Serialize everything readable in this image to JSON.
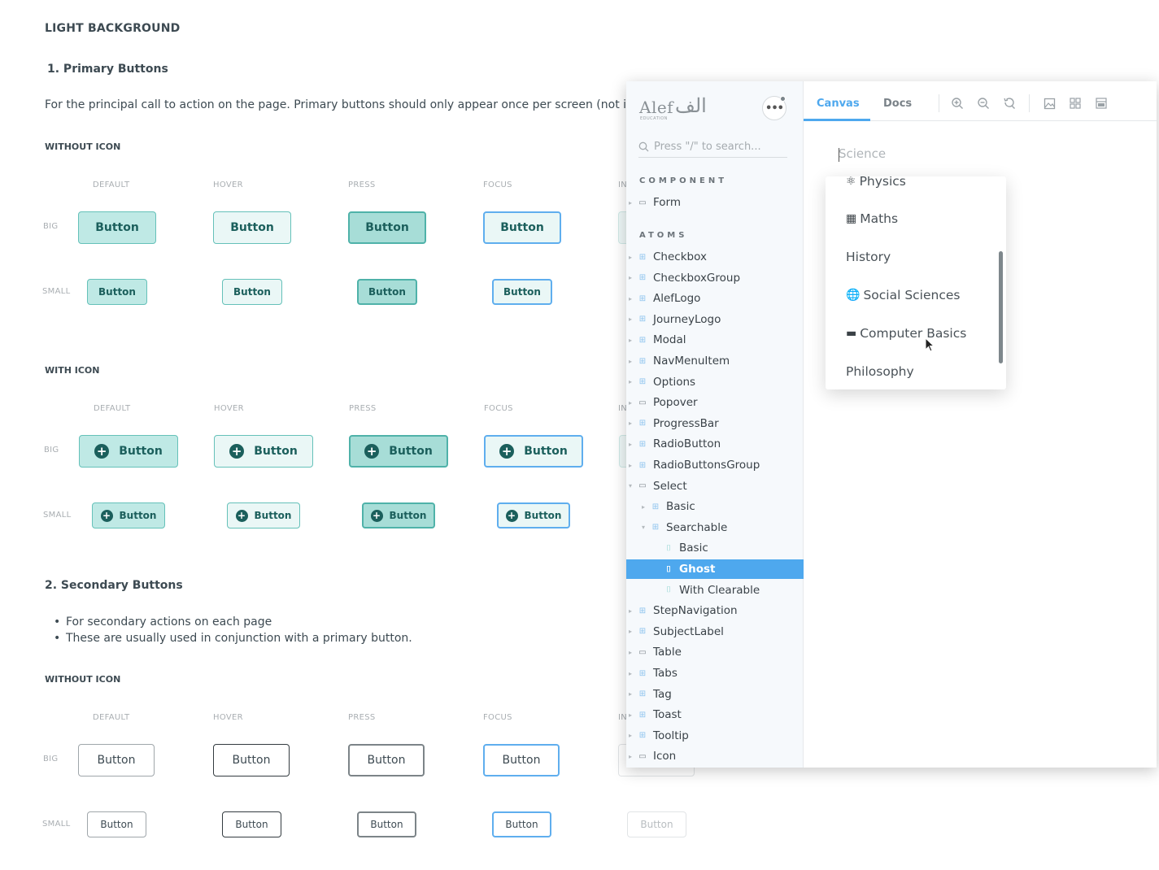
{
  "doc": {
    "title": "LIGHT BACKGROUND",
    "primary": {
      "heading": "1.  Primary Buttons",
      "description": "For the principal call to action on the page. Primary buttons should only appear once per screen (not includ",
      "without_icon": "WITHOUT ICON",
      "with_icon": "WITH ICON"
    },
    "secondary": {
      "heading": "2. Secondary Buttons",
      "bullets": [
        "For secondary actions on each page",
        "These are usually used in conjunction with a primary button."
      ],
      "without_icon": "WITHOUT ICON"
    },
    "states": {
      "default": "DEFAULT",
      "hover": "HOVER",
      "press": "PRESS",
      "focus": "FOCUS",
      "inactive_partial": "IN"
    },
    "sizes": {
      "big": "BIG",
      "small": "SMALL"
    },
    "button_label": "Button",
    "plus_glyph": "+"
  },
  "storybook": {
    "logo_text": "Alef",
    "logo_sub": "EDUCATION",
    "logo_arabic": "الف",
    "menu_glyph": "•••",
    "search_placeholder": "Press \"/\" to search...",
    "sections": {
      "component": "COMPONENT",
      "atoms": "ATOMS"
    },
    "component_items": [
      {
        "label": "Form",
        "kind": "folder"
      }
    ],
    "atoms_items": [
      {
        "label": "Checkbox",
        "kind": "comp"
      },
      {
        "label": "CheckboxGroup",
        "kind": "comp"
      },
      {
        "label": "AlefLogo",
        "kind": "comp"
      },
      {
        "label": "JourneyLogo",
        "kind": "comp"
      },
      {
        "label": "Modal",
        "kind": "comp"
      },
      {
        "label": "NavMenuItem",
        "kind": "comp"
      },
      {
        "label": "Options",
        "kind": "comp"
      },
      {
        "label": "Popover",
        "kind": "folder"
      },
      {
        "label": "ProgressBar",
        "kind": "comp"
      },
      {
        "label": "RadioButton",
        "kind": "comp"
      },
      {
        "label": "RadioButtonsGroup",
        "kind": "comp"
      },
      {
        "label": "Select",
        "kind": "folder",
        "expanded": true
      },
      {
        "label": "Basic",
        "kind": "comp",
        "depth": 1
      },
      {
        "label": "Searchable",
        "kind": "comp",
        "depth": 1,
        "expanded": true
      },
      {
        "label": "Basic",
        "kind": "story",
        "depth": 2
      },
      {
        "label": "Ghost",
        "kind": "story",
        "depth": 2,
        "selected": true
      },
      {
        "label": "With Clearable",
        "kind": "story",
        "depth": 2
      },
      {
        "label": "StepNavigation",
        "kind": "comp"
      },
      {
        "label": "SubjectLabel",
        "kind": "comp"
      },
      {
        "label": "Table",
        "kind": "folder"
      },
      {
        "label": "Tabs",
        "kind": "comp"
      },
      {
        "label": "Tag",
        "kind": "comp"
      },
      {
        "label": "Toast",
        "kind": "comp"
      },
      {
        "label": "Tooltip",
        "kind": "comp"
      },
      {
        "label": "Icon",
        "kind": "folder"
      }
    ],
    "tabs": {
      "canvas": "Canvas",
      "docs": "Docs"
    },
    "select": {
      "placeholder": "Science",
      "options": [
        {
          "label": "Physics",
          "icon": "physics-icon",
          "glyph": "⚛"
        },
        {
          "label": "Maths",
          "icon": "maths-icon",
          "glyph": "▦"
        },
        {
          "label": "History",
          "icon": "",
          "glyph": ""
        },
        {
          "label": "Social Sciences",
          "icon": "globe-icon",
          "glyph": "🌐"
        },
        {
          "label": "Computer Basics",
          "icon": "monitor-icon",
          "glyph": "▬"
        },
        {
          "label": "Philosophy",
          "icon": "",
          "glyph": ""
        }
      ]
    },
    "colors": {
      "accent": "#4ea8ee",
      "primary_bg": "#bfe9e5",
      "primary_text": "#1b5f5c"
    }
  }
}
